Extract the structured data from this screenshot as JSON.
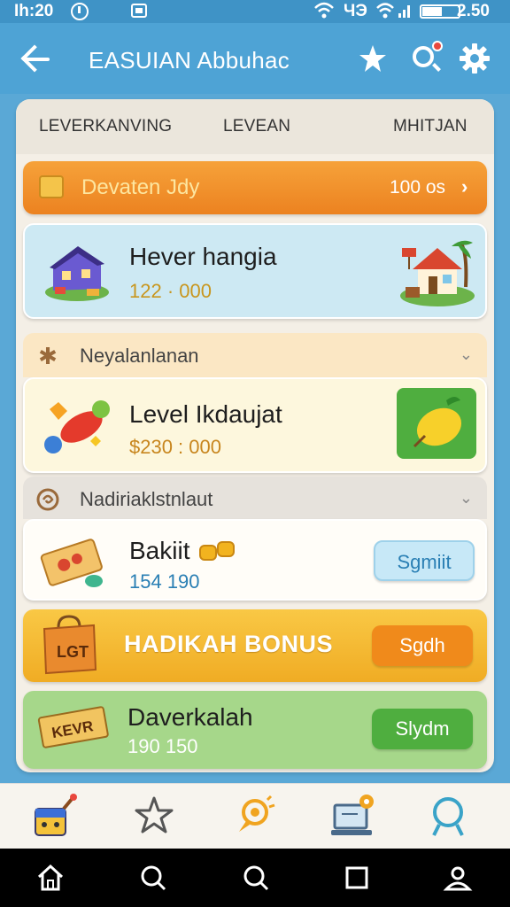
{
  "status_bar": {
    "time": "Ih:20",
    "carrier": "ЧЭ",
    "battery": "2.50",
    "icons": [
      "clock-icon",
      "notification-icon",
      "wifi-icon",
      "signal-icon",
      "battery-icon"
    ]
  },
  "header": {
    "title": "EASUIAN Abbuhac",
    "icons": [
      "back-arrow-icon",
      "star-icon",
      "search-icon",
      "gear-icon"
    ],
    "accent_color": "#4ea3d5"
  },
  "tabs": [
    {
      "label": "LEVERKANVING"
    },
    {
      "label": "LEVEAN"
    },
    {
      "label": "MHITJAN"
    }
  ],
  "daily_banner": {
    "label": "Devaten Jdy",
    "value": "100 os",
    "icon": "crate-icon",
    "color": "#ec8220"
  },
  "cards": {
    "house": {
      "title": "Hever hangia",
      "amount": "122 · 000",
      "amount_color": "#c8961e"
    },
    "section_one": {
      "label": "Neyalanlanan",
      "icon": "star-badge-icon"
    },
    "level": {
      "title": "Level Ikdaujat",
      "amount": "$230 : 000",
      "amount_color": "#c8861e"
    },
    "section_two": {
      "label": "Nadiriaklstnlaut",
      "icon": "spiral-icon"
    },
    "bakiit": {
      "title": "Bakiit",
      "amount": "154 190",
      "amount_color": "#2a7fb4",
      "button": "Sgmiit"
    },
    "bonus": {
      "title": "HADIKAH BONUS",
      "bag_text": "LGT",
      "button": "Sgdh"
    },
    "daverkalah": {
      "title": "Daverkalah",
      "amount": "190 150",
      "ticket_text": "KEVR",
      "button": "Slydm"
    }
  },
  "bottom_nav": [
    "paint-box-icon",
    "star-outline-icon",
    "lightbulb-icon",
    "computer-icon",
    "search-icon"
  ],
  "system_nav": [
    "home-icon",
    "search-icon",
    "search-icon",
    "square-icon",
    "user-icon"
  ]
}
